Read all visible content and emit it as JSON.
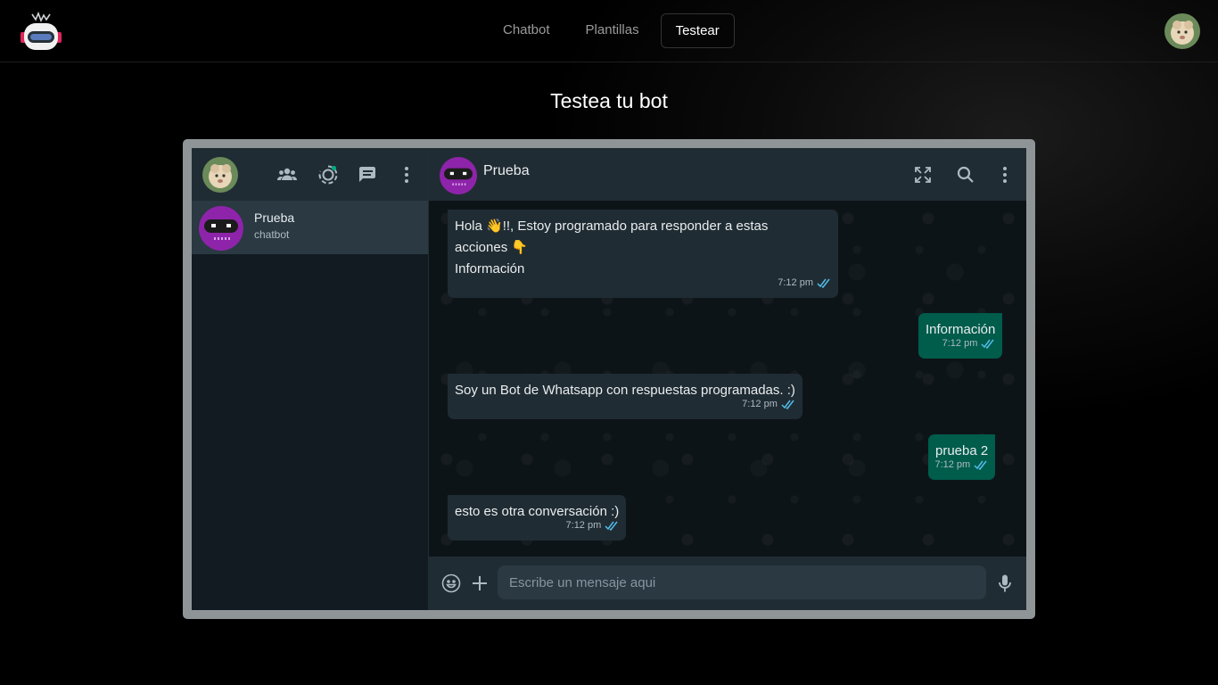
{
  "nav": {
    "items": [
      {
        "label": "Chatbot"
      },
      {
        "label": "Plantillas"
      },
      {
        "label": "Testear",
        "active": true
      }
    ]
  },
  "page": {
    "title": "Testea tu bot"
  },
  "sidebar": {
    "chats": [
      {
        "name": "Prueba",
        "subtitle": "chatbot"
      }
    ]
  },
  "conversation": {
    "contact_name": "Prueba",
    "messages": [
      {
        "direction": "in",
        "lines": [
          "Hola 👋!!, Estoy programado para responder a estas",
          "acciones 👇",
          "Información"
        ],
        "time": "7:12 pm"
      },
      {
        "direction": "out",
        "text": "Información",
        "time": "7:12 pm"
      },
      {
        "direction": "in",
        "text": "Soy un Bot de Whatsapp con respuestas programadas. :)",
        "time": "7:12 pm"
      },
      {
        "direction": "out",
        "text": "prueba 2",
        "time": "7:12 pm"
      },
      {
        "direction": "in",
        "text": "esto es otra conversación :)",
        "time": "7:12 pm"
      }
    ]
  },
  "composer": {
    "placeholder": "Escribe un mensaje aqui"
  },
  "colors": {
    "incoming_bubble": "#202c33",
    "outgoing_bubble": "#005c4b",
    "bot_avatar": "#8e24aa",
    "read_ticks": "#53bdeb"
  },
  "icons": [
    "robot-logo-icon",
    "community-icon",
    "status-icon",
    "new-chat-icon",
    "menu-dots-icon",
    "fullscreen-icon",
    "search-icon",
    "emoji-icon",
    "plus-icon",
    "mic-icon"
  ]
}
